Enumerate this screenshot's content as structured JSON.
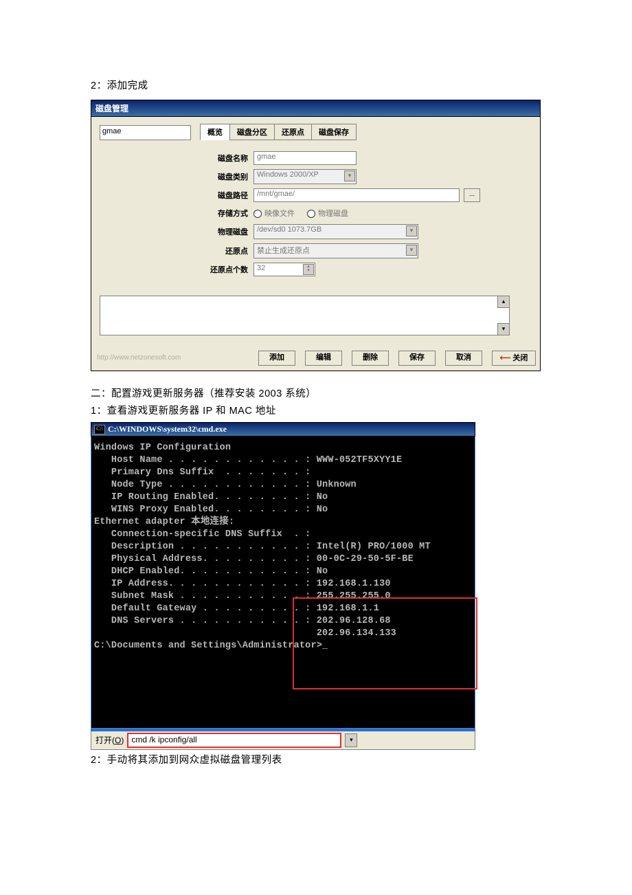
{
  "doc": {
    "p1": "2：添加完成",
    "p2": "二：配置游戏更新服务器（推荐安装 2003 系统）",
    "p3": "1：查看游戏更新服务器 IP 和 MAC 地址",
    "p4": "2：手动将其添加到网众虚拟磁盘管理列表"
  },
  "dlg": {
    "title": "磁盘管理",
    "list_selected": "gmae",
    "tab0": "概览",
    "tab1": "磁盘分区",
    "tab2": "还原点",
    "tab3": "磁盘保存",
    "labels": {
      "disk_name": "磁盘名称",
      "disk_type": "磁盘类别",
      "disk_path": "磁盘路径",
      "store_mode": "存储方式",
      "phys_disk": "物理磁盘",
      "restore": "还原点",
      "restore_n": "还原点个数"
    },
    "values": {
      "disk_name": "gmae",
      "disk_type": "Windows 2000/XP",
      "disk_path": "/mnt/gmae/",
      "radio1": "映像文件",
      "radio2": "物理磁盘",
      "phys_disk": "/dev/sd0 1073.7GB",
      "restore": "禁止生成还原点",
      "restore_n": "32"
    },
    "watermark": "http://www.netzonesoft.com",
    "btns": {
      "add": "添加",
      "edit": "编辑",
      "del": "删除",
      "save": "保存",
      "cancel": "取消",
      "close": "关闭"
    }
  },
  "cmd": {
    "title": "C:\\WINDOWS\\system32\\cmd.exe",
    "l_blank": "",
    "l_hdr": "Windows IP Configuration",
    "l01": "   Host Name . . . . . . . . . . . . : WWW-052TF5XYY1E",
    "l02": "   Primary Dns Suffix  . . . . . . . :",
    "l03": "   Node Type . . . . . . . . . . . . : Unknown",
    "l04": "   IP Routing Enabled. . . . . . . . : No",
    "l05": "   WINS Proxy Enabled. . . . . . . . : No",
    "l_eth": "Ethernet adapter 本地连接:",
    "l06": "   Connection-specific DNS Suffix  . :",
    "l07": "   Description . . . . . . . . . . . : Intel(R) PRO/1000 MT",
    "l08": "   Physical Address. . . . . . . . . : 00-0C-29-50-5F-BE",
    "l09": "   DHCP Enabled. . . . . . . . . . . : No",
    "l10": "   IP Address. . . . . . . . . . . . : 192.168.1.130",
    "l11": "   Subnet Mask . . . . . . . . . . . : 255.255.255.0",
    "l12": "   Default Gateway . . . . . . . . . : 192.168.1.1",
    "l13": "   DNS Servers . . . . . . . . . . . : 202.96.128.68",
    "l14": "                                       202.96.134.133",
    "l_prompt": "C:\\Documents and Settings\\Administrator>_",
    "run_label_pre": "打开(",
    "run_label_u": "O",
    "run_label_post": ")",
    "run_value": "cmd /k ipconfig/all"
  }
}
